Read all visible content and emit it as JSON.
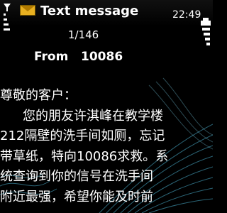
{
  "header": {
    "title": "Text message",
    "time": "22:49",
    "icons": [
      "envelope-icon",
      "signal-icon",
      "battery-icon"
    ]
  },
  "message": {
    "counter": "1/146",
    "from_label": "From",
    "from_value": "10086",
    "body_lines": [
      "尊敬的客户：",
      "您的朋友许淇峰在教学楼",
      "212隔壁的洗手间如厕，忘记",
      "带草纸，特向10086求救。系",
      "统查询到你的信号在洗手间",
      "附近最强，希望你能及时前"
    ]
  },
  "colors": {
    "background": "#000000",
    "text": "#ffffff",
    "envelope": "#e8b020",
    "waves": "#4fb8d8"
  }
}
